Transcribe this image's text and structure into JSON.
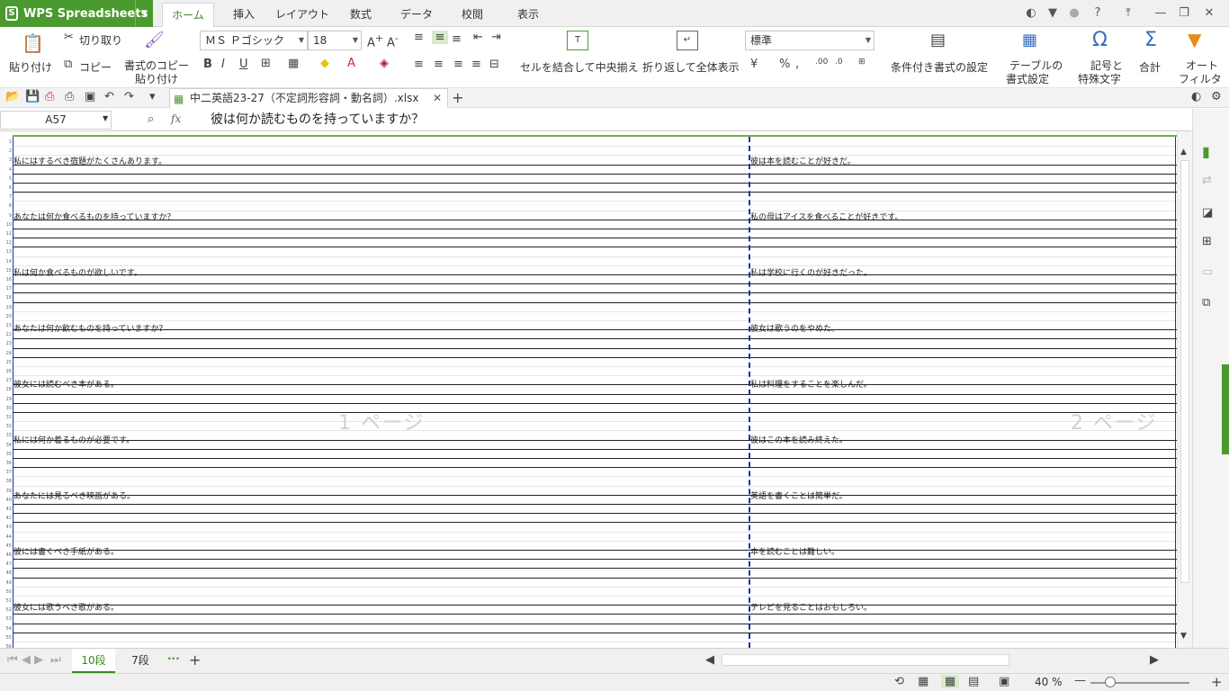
{
  "app": {
    "name": "WPS Spreadsheets"
  },
  "menu_tabs": [
    "ホーム",
    "挿入",
    "レイアウト",
    "数式",
    "データ",
    "校閲",
    "表示"
  ],
  "ribbon": {
    "paste": "貼り付け",
    "cut": "切り取り",
    "copy": "コピー",
    "format_copy_1": "書式のコピー",
    "format_copy_2": "貼り付け",
    "font_name": "ＭＳ Ｐゴシック",
    "font_size": "18",
    "bold": "B",
    "italic": "I",
    "underline": "U",
    "merge_center": "セルを結合して中央揃え",
    "wrap_text": "折り返して全体表示",
    "number_format": "標準",
    "percent": "%",
    "conditional_format": "条件付き書式の設定",
    "table_format_1": "テーブルの",
    "table_format_2": "書式設定",
    "symbol_1": "記号と",
    "symbol_2": "特殊文字",
    "sum": "合計",
    "autofilter_1": "オート",
    "autofilter_2": "フィルタ"
  },
  "document": {
    "tab_title": "中二英語23-27（不定詞形容詞・動名詞）.xlsx"
  },
  "formula_bar": {
    "name_box": "A57",
    "fx": "fx",
    "content": "彼は何か読むものを持っていますか？"
  },
  "sheet": {
    "page_labels": [
      "1 ページ",
      "2 ページ"
    ],
    "left_column": [
      {
        "row": "3",
        "text": "私にはするべき宿題がたくさんあります。"
      },
      {
        "row": "9",
        "text": "あなたは何か食べるものを持っていますか？"
      },
      {
        "row": "15",
        "text": "私は何か食べるものが欲しいです。"
      },
      {
        "row": "21",
        "text": "あなたは何か飲むものを持っていますか？"
      },
      {
        "row": "27",
        "text": "彼女には読むべき本がある。"
      },
      {
        "row": "33",
        "text": "私には何か着るものが必要です。"
      },
      {
        "row": "39",
        "text": "あなたには見るべき映画がある。"
      },
      {
        "row": "45",
        "text": "彼には書くべき手紙がある。"
      },
      {
        "row": "51",
        "text": "彼女には歌うべき歌がある。"
      }
    ],
    "right_column": [
      {
        "text": "彼は本を読むことが好きだ。"
      },
      {
        "text": "私の母はアイスを食べることが好きです。"
      },
      {
        "text": "私は学校に行くのが好きだった。"
      },
      {
        "text": "彼女は歌うのをやめた。"
      },
      {
        "text": "私は料理をすることを楽しんだ。"
      },
      {
        "text": "彼はこの本を読み終えた。"
      },
      {
        "text": "英語を書くことは簡単だ。"
      },
      {
        "text": "本を読むことは難しい。"
      },
      {
        "text": "テレビを見ることはおもしろい。"
      }
    ],
    "row_numbers": [
      "1",
      "2",
      "3",
      "4",
      "5",
      "6",
      "7",
      "8",
      "9",
      "10",
      "11",
      "12",
      "13",
      "14",
      "15",
      "16",
      "17",
      "18",
      "19",
      "20",
      "21",
      "22",
      "23",
      "24",
      "25",
      "26",
      "27",
      "28",
      "29",
      "30",
      "31",
      "32",
      "33",
      "34",
      "35",
      "36",
      "37",
      "38",
      "39",
      "40",
      "41",
      "42",
      "43",
      "44",
      "45",
      "46",
      "47",
      "48",
      "49",
      "50",
      "51",
      "52",
      "53",
      "54",
      "55",
      "56"
    ]
  },
  "sheet_tabs": [
    "10段",
    "7段"
  ],
  "sheet_tabs_more": "···",
  "status": {
    "zoom": "40 %"
  },
  "colors": {
    "accent": "#4a9a2f",
    "page_break": "#1a2fb3"
  }
}
